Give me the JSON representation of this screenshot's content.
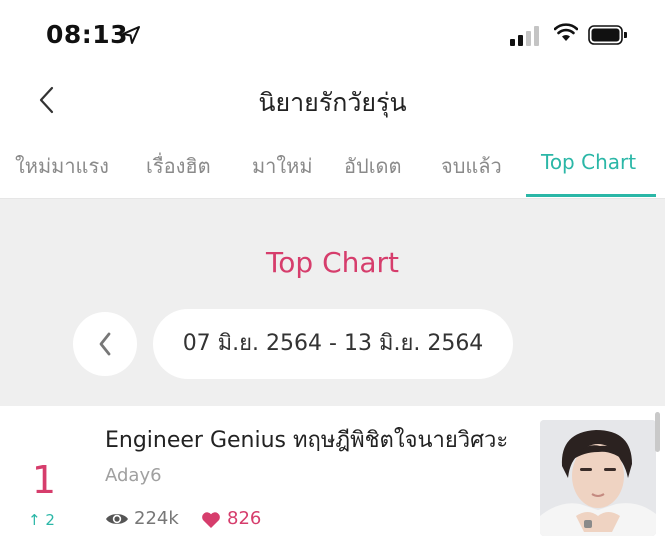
{
  "status_bar": {
    "time": "08:13",
    "icons": [
      "location-arrow-icon",
      "signal-icon",
      "wifi-icon",
      "battery-icon"
    ]
  },
  "header": {
    "title": "นิยายรักวัยรุ่น",
    "back_icon": "chevron-left-icon"
  },
  "tabs": [
    {
      "label": "ใหม่มาแรง",
      "active": false
    },
    {
      "label": "เรื่องฮิต",
      "active": false
    },
    {
      "label": "มาใหม่",
      "active": false
    },
    {
      "label": "อัปเดต",
      "active": false
    },
    {
      "label": "จบแล้ว",
      "active": false
    },
    {
      "label": "Top Chart",
      "active": true
    }
  ],
  "chart_header": {
    "title": "Top Chart",
    "date_range": "07 มิ.ย. 2564 - 13 มิ.ย. 2564",
    "prev_icon": "chevron-left-icon"
  },
  "items": [
    {
      "rank": "1",
      "rank_change": "↑ 2",
      "title": "Engineer Genius ทฤษฎีพิชิตใจนายวิศวะ",
      "author": "Aday6",
      "views": "224k",
      "likes": "826",
      "views_icon": "eye-icon",
      "likes_icon": "heart-icon",
      "thumbnail_icon": "cover-image"
    }
  ],
  "colors": {
    "accent_teal": "#2bb7a7",
    "accent_pink": "#d63d6c",
    "section_bg": "#efefef"
  }
}
